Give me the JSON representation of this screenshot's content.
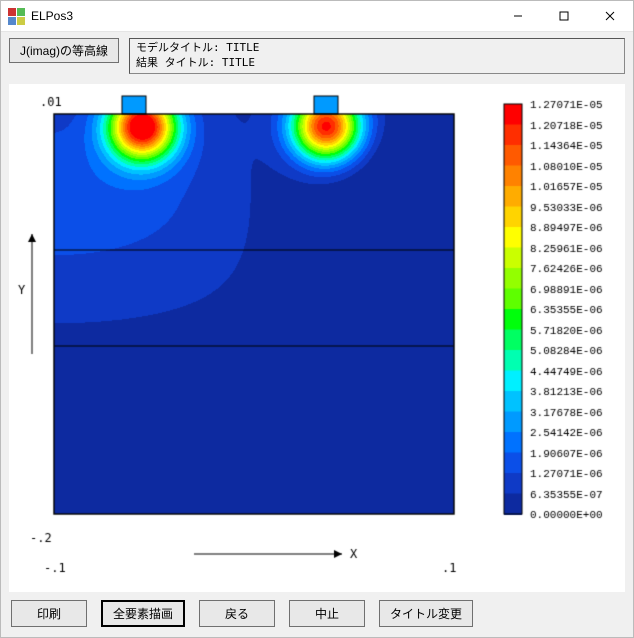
{
  "window": {
    "title": "ELPos3"
  },
  "toolbar": {
    "contour_btn": "J(imag)の等高線"
  },
  "info": {
    "line1": "モデルタイトル: TITLE",
    "line2": "結果   タイトル: TITLE"
  },
  "axes": {
    "y_label": "Y",
    "x_label": "X",
    "y_top": ".01",
    "y_bottom": "-.2",
    "x_left": "-.1",
    "x_right": ".1"
  },
  "chart_data": {
    "type": "heatmap",
    "title": "J(imag)の等高線",
    "xlabel": "X",
    "ylabel": "Y",
    "xlim": [
      -0.1,
      0.1
    ],
    "ylim": [
      -0.2,
      0.01
    ],
    "value_range": [
      0.0,
      1.27071e-05
    ],
    "description": "Contour/heatmap of imaginary current density J(imag). Two hot spots sit at the top edge near tabs around x≈-0.06 and x≈0.03 (values ~1.0e-05 to 1.27e-05). Field decays to ~5e-07–2e-06 over most of the rectangular domain. Horizontal black section lines at roughly y≈-0.04 and y≈-0.095.",
    "hotspots": [
      {
        "x": -0.06,
        "y": 0.0,
        "peak": 1.27071e-05
      },
      {
        "x": 0.03,
        "y": 0.0,
        "peak": 1.2e-05
      }
    ],
    "section_lines_y": [
      -0.04,
      -0.095
    ]
  },
  "legend": [
    {
      "v": 1.27071e-05,
      "label": "1.27071E-05",
      "c": "#ff0000"
    },
    {
      "v": 1.20718e-05,
      "label": "1.20718E-05",
      "c": "#ff2e00"
    },
    {
      "v": 1.14364e-05,
      "label": "1.14364E-05",
      "c": "#ff5a00"
    },
    {
      "v": 1.0801e-05,
      "label": "1.08010E-05",
      "c": "#ff8200"
    },
    {
      "v": 1.01657e-05,
      "label": "1.01657E-05",
      "c": "#ffac00"
    },
    {
      "v": 9.53033e-06,
      "label": "9.53033E-06",
      "c": "#ffd400"
    },
    {
      "v": 8.89497e-06,
      "label": "8.89497E-06",
      "c": "#ffff00"
    },
    {
      "v": 8.25961e-06,
      "label": "8.25961E-06",
      "c": "#caff00"
    },
    {
      "v": 7.62426e-06,
      "label": "7.62426E-06",
      "c": "#93ff00"
    },
    {
      "v": 6.98891e-06,
      "label": "6.98891E-06",
      "c": "#5eff00"
    },
    {
      "v": 6.35355e-06,
      "label": "6.35355E-06",
      "c": "#00ff0c"
    },
    {
      "v": 5.7182e-06,
      "label": "5.71820E-06",
      "c": "#00ff62"
    },
    {
      "v": 5.08284e-06,
      "label": "5.08284E-06",
      "c": "#00ffb1"
    },
    {
      "v": 4.44749e-06,
      "label": "4.44749E-06",
      "c": "#00f0ff"
    },
    {
      "v": 3.81213e-06,
      "label": "3.81213E-06",
      "c": "#00c2ff"
    },
    {
      "v": 3.17678e-06,
      "label": "3.17678E-06",
      "c": "#009aff"
    },
    {
      "v": 2.54142e-06,
      "label": "2.54142E-06",
      "c": "#0072ff"
    },
    {
      "v": 1.90607e-06,
      "label": "1.90607E-06",
      "c": "#0b4fe8"
    },
    {
      "v": 1.27071e-06,
      "label": "1.27071E-06",
      "c": "#0f3ac6"
    },
    {
      "v": 6.35355e-07,
      "label": "6.35355E-07",
      "c": "#0d2aa0"
    },
    {
      "v": 0.0,
      "label": "0.00000E+00",
      "c": "#0a1d86"
    }
  ],
  "buttons": {
    "print": "印刷",
    "draw_all": "全要素描画",
    "back": "戻る",
    "stop": "中止",
    "title_change": "タイトル変更"
  }
}
